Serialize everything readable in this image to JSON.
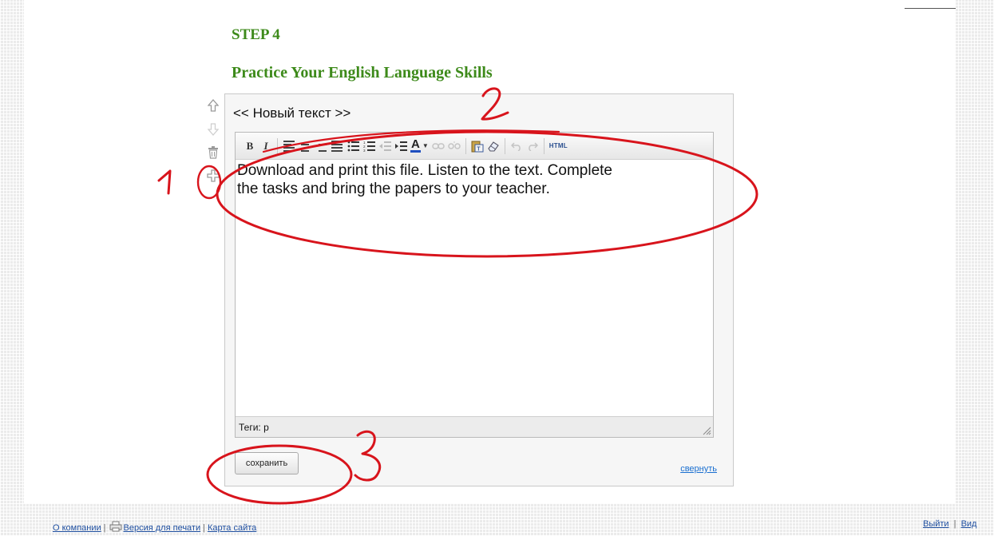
{
  "content": {
    "step": "STEP 4",
    "section_title": "Practice Your English Language Skills"
  },
  "block_tools": [
    {
      "name": "move-up-icon",
      "glyph": "⇧"
    },
    {
      "name": "move-down-icon",
      "glyph": "⇩"
    },
    {
      "name": "delete-icon",
      "glyph": "🗑"
    },
    {
      "name": "add-block-icon",
      "glyph": "✚"
    }
  ],
  "editor": {
    "caption": "<< Новый текст >>",
    "toolbar": {
      "bold": "B",
      "italic": "I",
      "font_color": "A",
      "html_button": "HTML"
    },
    "text": "Download and print this file. Listen to the text. Complete\nthe tasks and bring the papers to your teacher.",
    "status": "Теги: p",
    "save_label": "сохранить",
    "collapse_label": "свернуть"
  },
  "annotations": [
    {
      "name": "annotation-number-1",
      "text": "1"
    },
    {
      "name": "annotation-number-2",
      "text": "2"
    },
    {
      "name": "annotation-number-3",
      "text": "3"
    }
  ],
  "footer": {
    "about": "О компании",
    "print_version": "Версия для печати",
    "sitemap": "Карта сайта",
    "logout": "Выйти",
    "view": "Вид"
  },
  "colors": {
    "heading": "#3d8a1a",
    "link": "#1a6fd0",
    "annotation": "#d8141c"
  }
}
